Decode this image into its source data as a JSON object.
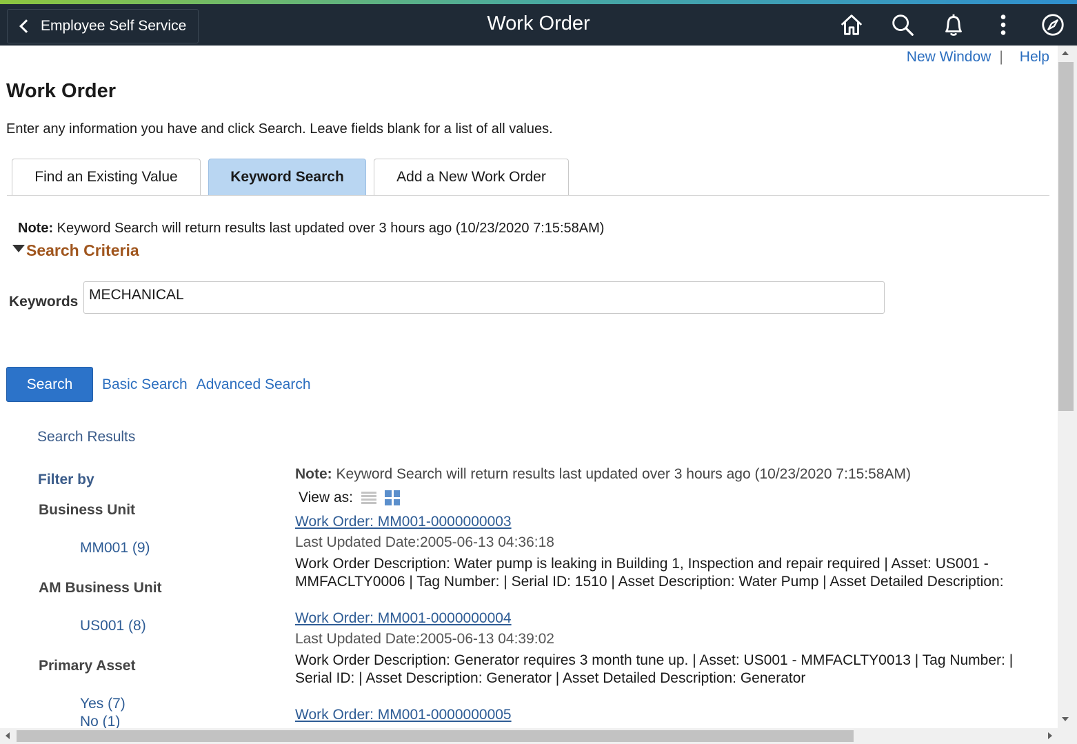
{
  "header": {
    "back_label": "Employee Self Service",
    "title": "Work Order",
    "icons": [
      "home-icon",
      "search-icon",
      "notification-bell-icon",
      "more-actions-icon",
      "navbar-compass-icon"
    ]
  },
  "toplinks": {
    "new_window": "New Window",
    "separator": "|",
    "help": "Help"
  },
  "page": {
    "title": "Work Order",
    "instructions": "Enter any information you have and click Search. Leave fields blank for a list of all values."
  },
  "tabs": [
    {
      "label": "Find an Existing Value",
      "active": false
    },
    {
      "label": "Keyword Search",
      "active": true
    },
    {
      "label": "Add a New Work Order",
      "active": false
    }
  ],
  "note": {
    "prefix": "Note:",
    "text": "Keyword Search will return results last updated over 3 hours ago (10/23/2020 7:15:58AM)"
  },
  "criteria": {
    "title": "Search Criteria",
    "keywords_label": "Keywords",
    "keywords_value": "MECHANICAL"
  },
  "actions": {
    "search": "Search",
    "basic_search": "Basic Search",
    "advanced_search": "Advanced Search"
  },
  "results": {
    "heading": "Search Results",
    "filter_title": "Filter by",
    "facets": [
      {
        "name": "Business Unit",
        "values": [
          "MM001 (9)"
        ]
      },
      {
        "name": "AM Business Unit",
        "values": [
          "US001 (8)"
        ]
      },
      {
        "name": "Primary Asset",
        "values": [
          "Yes (7)",
          "No (1)"
        ]
      }
    ],
    "view_as": "View as:",
    "items": [
      {
        "link": "Work Order: MM001-0000000003",
        "date": "Last Updated Date:2005-06-13 04:36:18",
        "desc": "Work Order Description: Water pump is leaking in Building 1, Inspection and repair required | Asset: US001 - MMFACLTY0006 | Tag Number: | Serial ID: 1510 | Asset Description: Water Pump | Asset Detailed Description:"
      },
      {
        "link": "Work Order: MM001-0000000004",
        "date": "Last Updated Date:2005-06-13 04:39:02",
        "desc": "Work Order Description: Generator requires 3 month tune up. | Asset: US001 - MMFACLTY0013 | Tag Number: | Serial ID: | Asset Description: Generator | Asset Detailed Description: Generator"
      },
      {
        "link": "Work Order: MM001-0000000005"
      }
    ]
  },
  "colors": {
    "header_bg": "#1f2a36",
    "link": "#2b6ebf",
    "active_tab": "#b9d6f2",
    "criteria_title": "#a0561e",
    "search_button": "#2c73c9"
  }
}
